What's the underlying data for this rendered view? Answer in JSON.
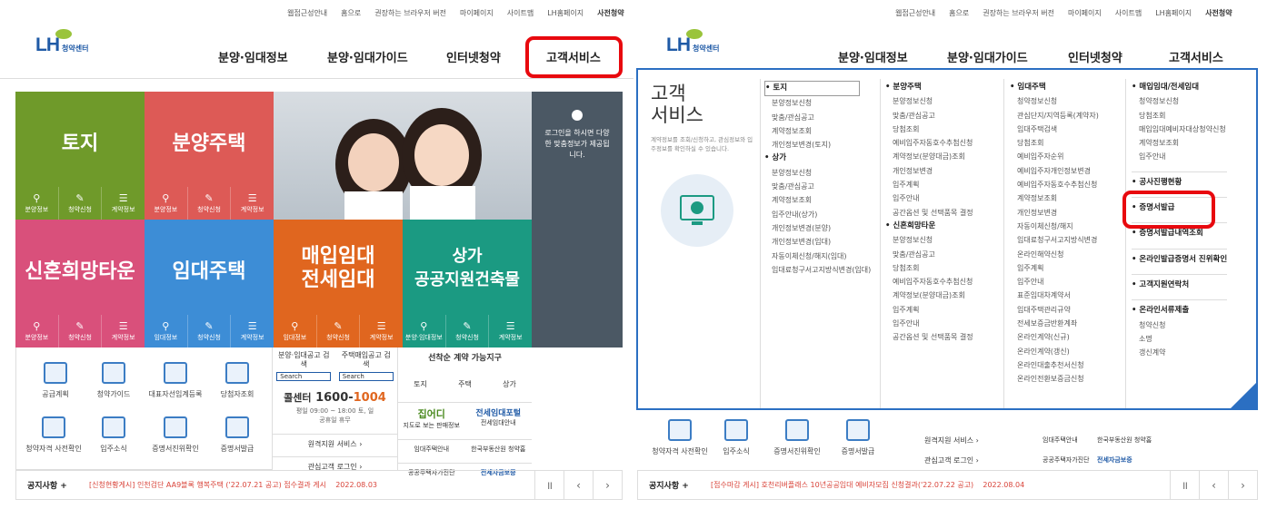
{
  "util_links": [
    "웹접근성안내",
    "홈으로",
    "권장하는 브라우저 버전",
    "마이페이지",
    "사이트맵",
    "LH홈페이지",
    "사전청약"
  ],
  "logo": {
    "lh": "LH",
    "sub": "청약센터"
  },
  "gnav": [
    "분양·임대정보",
    "분양·임대가이드",
    "인터넷청약",
    "고객서비스"
  ],
  "tiles": [
    {
      "title": "토지",
      "color": "#6f9a2a"
    },
    {
      "title": "분양주택",
      "color": "#dd5a56"
    },
    {
      "title": "신혼희망타운",
      "color": "#d9507b"
    },
    {
      "title": "임대주택",
      "color": "#3d8dd6"
    },
    {
      "title": "매입임대\n전세임대",
      "color": "#e0661f"
    },
    {
      "title": "상가\n공공지원건축물",
      "color": "#1b9a82"
    }
  ],
  "tile_buttons": [
    "분양정보",
    "청약신청",
    "계약정보"
  ],
  "tile_buttons_alt": [
    "임대정보",
    "청약신청",
    "계약정보"
  ],
  "tile_buttons_alt2": [
    "분양·임대정보",
    "청약신청",
    "계약정보"
  ],
  "side_banner": "로그인을 하시면 다양한 맞춤정보가 제공됩니다.",
  "quick_links": [
    "공급계획",
    "청약가이드",
    "대표자선임계등록",
    "당첨자조회",
    "청약자격 사전확인",
    "입주소식",
    "증명서진위확인",
    "증명서발급"
  ],
  "search": {
    "a": "분양·임대공고 검색",
    "b": "주택매입공고 검색",
    "btn": "Search"
  },
  "callcenter": {
    "label": "콜센터",
    "num1": "1600-",
    "num2": "1004",
    "hours": "평일 09:00 ~ 18:00 토, 일 공휴일 휴무"
  },
  "links": {
    "remote": "원격지원 서비스 ›",
    "login": "관심고객 로그인 ›"
  },
  "first_contract": {
    "title": "선착순 계약 가능지구",
    "items": [
      "토지",
      "주택",
      "상가"
    ]
  },
  "banners": {
    "jibeodi": "집어디",
    "jibeodi_sub": "지도로 보는 판매정보",
    "jeonse": "전세임대포털",
    "jeonse_sub": "전세임대안내",
    "imdae": "임대주택안내",
    "hanguk": "한국부동산원 청약홈",
    "gongong": "공공주택자가진단",
    "hf": "전세자금보증"
  },
  "notice_label": "공지사항 +",
  "notice_left": "[신청현황게시] 인천검단 AA9블록 행복주택 ('22.07.21 공고) 접수결과 게시",
  "notice_left_date": "2022.08.03",
  "notice_right": "[접수마감 게시] 호천리버플래스 10년공공임대 예비자모집 신청결과('22.07.22 공고)",
  "notice_right_date": "2022.08.04",
  "mega": {
    "title": "고객\n서비스",
    "desc": "계약정보를 조회/신청하고, 관심정보와 입주정보를 확인하실 수 있습니다.",
    "col1": [
      [
        "h",
        "• 토지"
      ],
      [
        "i",
        "분양정보신청"
      ],
      [
        "i",
        "맞춤/관심공고"
      ],
      [
        "i",
        "계약정보조회"
      ],
      [
        "i",
        "개인정보변경(토지)"
      ],
      [
        "h",
        "• 상가"
      ],
      [
        "i",
        "분양정보신청"
      ],
      [
        "i",
        "맞춤/관심공고"
      ],
      [
        "i",
        "계약정보조회"
      ],
      [
        "i",
        "입주안내(상가)"
      ],
      [
        "i",
        "개인정보변경(분양)"
      ],
      [
        "i",
        "개인정보변경(임대)"
      ],
      [
        "i",
        "자동이체신청/해지(임대)"
      ],
      [
        "i",
        "임대료청구서고지방식변경(임대)"
      ]
    ],
    "col2": [
      [
        "h",
        "• 분양주택"
      ],
      [
        "i",
        "분양정보신청"
      ],
      [
        "i",
        "맞춤/관심공고"
      ],
      [
        "i",
        "당첨조회"
      ],
      [
        "i",
        "예비입주자동호수추첨신청"
      ],
      [
        "i",
        "계약정보(분양대금)조회"
      ],
      [
        "i",
        "개인정보변경"
      ],
      [
        "i",
        "입주계획"
      ],
      [
        "i",
        "입주안내"
      ],
      [
        "i",
        "공간옵션 및 선택품목 결정"
      ],
      [
        "h",
        "• 신혼희망타운"
      ],
      [
        "i",
        "분양정보신청"
      ],
      [
        "i",
        "맞춤/관심공고"
      ],
      [
        "i",
        "당첨조회"
      ],
      [
        "i",
        "예비입주자동호수추첨신청"
      ],
      [
        "i",
        "계약정보(분양대금)조회"
      ],
      [
        "i",
        "입주계획"
      ],
      [
        "i",
        "입주안내"
      ],
      [
        "i",
        "공간옵션 및 선택품목 결정"
      ]
    ],
    "col3": [
      [
        "h",
        "• 임대주택"
      ],
      [
        "i",
        "청약정보신청"
      ],
      [
        "i",
        "관심단지/지역등록(계약자)"
      ],
      [
        "i",
        "임대주택검색"
      ],
      [
        "i",
        "당첨조회"
      ],
      [
        "i",
        "예비입주자순위"
      ],
      [
        "i",
        "예비입주자개인정보변경"
      ],
      [
        "i",
        "예비입주자동호수추첨신청"
      ],
      [
        "i",
        "계약정보조회"
      ],
      [
        "i",
        "개인정보변경"
      ],
      [
        "i",
        "자동이체신청/해지"
      ],
      [
        "i",
        "임대료청구서고지방식변경"
      ],
      [
        "i",
        "온라인해약신청"
      ],
      [
        "i",
        "입주계획"
      ],
      [
        "i",
        "입주안내"
      ],
      [
        "i",
        "표준임대차계약서"
      ],
      [
        "i",
        "임대주택관리규약"
      ],
      [
        "i",
        "전세보증금반환계좌"
      ],
      [
        "i",
        "온라인계약(신규)"
      ],
      [
        "i",
        "온라인계약(갱신)"
      ],
      [
        "i",
        "온라인대출추천서신청"
      ],
      [
        "i",
        "온라인전환보증금신청"
      ]
    ],
    "col4": [
      [
        "h",
        "• 매입임대/전세임대"
      ],
      [
        "i",
        "청약정보신청"
      ],
      [
        "i",
        "당첨조회"
      ],
      [
        "i",
        "매입임대예비자대상청약신청"
      ],
      [
        "i",
        "계약정보조회"
      ],
      [
        "i",
        "입주안내"
      ],
      [
        "h",
        "• 공사진행현황"
      ],
      [
        "h",
        "• 증명서발급"
      ],
      [
        "h",
        "• 증명서발급내역조회"
      ],
      [
        "h",
        "• 온라인발급증명서 진위확인"
      ],
      [
        "h",
        "• 고객지원연락처"
      ],
      [
        "h",
        "• 온라인서류제출"
      ],
      [
        "i",
        "청약신청"
      ],
      [
        "i",
        "소명"
      ],
      [
        "i",
        "갱신계약"
      ]
    ]
  }
}
